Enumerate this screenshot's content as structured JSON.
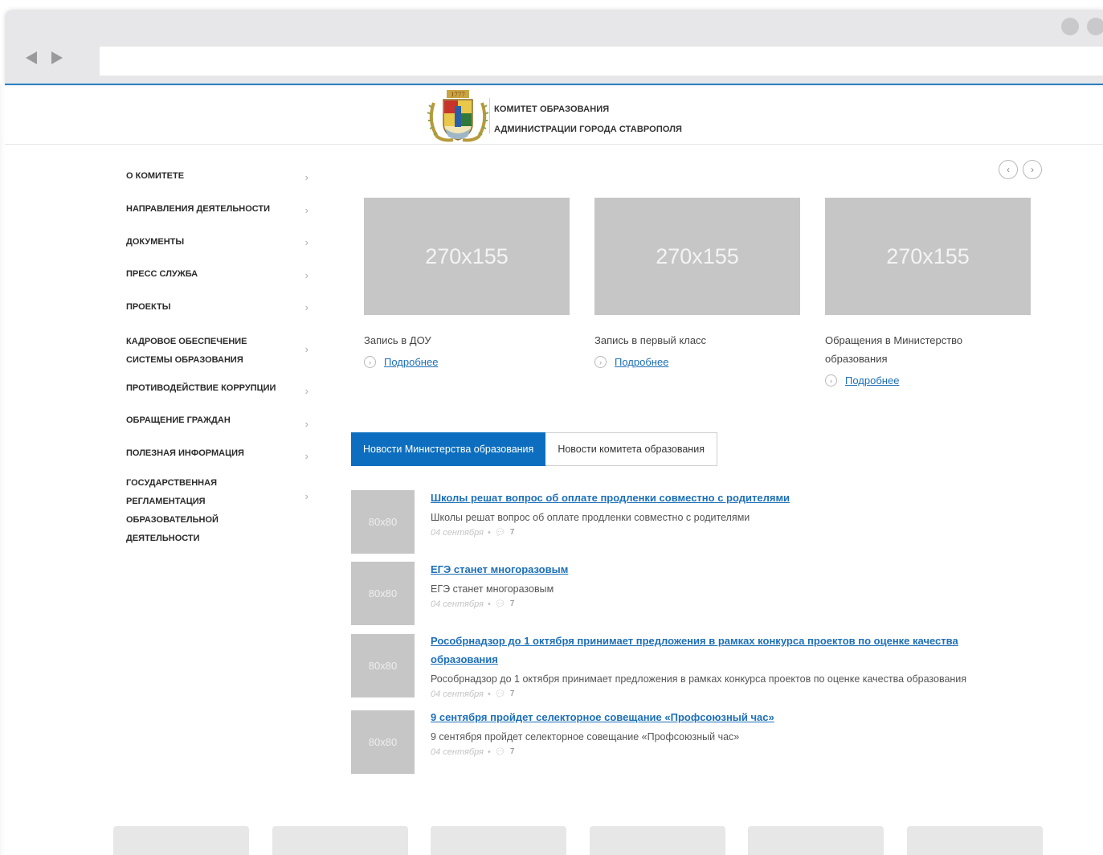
{
  "header": {
    "title_line1": "КОМИТЕТ ОБРАЗОВАНИЯ",
    "title_line2": "АДМИНИСТРАЦИИ ГОРОДА СТАВРОПОЛЯ",
    "emblem_year": "1777",
    "emblem_icon": "coat-of-arms"
  },
  "sidebar": {
    "chevron": "›",
    "items": [
      {
        "label": "О КОМИТЕТЕ"
      },
      {
        "label": "НАПРАВЛЕНИЯ ДЕЯТЕЛЬНОСТИ"
      },
      {
        "label": "ДОКУМЕНТЫ"
      },
      {
        "label": "ПРЕСС СЛУЖБА"
      },
      {
        "label": "ПРОЕКТЫ"
      },
      {
        "label": "КАДРОВОЕ ОБЕСПЕЧЕНИЕ СИСТЕМЫ ОБРАЗОВАНИЯ"
      },
      {
        "label": "ПРОТИВОДЕЙСТВИЕ КОРРУПЦИИ"
      },
      {
        "label": "ОБРАЩЕНИЕ ГРАЖДАН"
      },
      {
        "label": "ПОЛЕЗНАЯ ИНФОРМАЦИЯ"
      },
      {
        "label": "ГОСУДАРСТВЕННАЯ РЕГЛАМЕНТАЦИЯ ОБРАЗОВАТЕЛЬНОЙ ДЕЯТЕЛЬНОСТИ"
      }
    ]
  },
  "carousel": {
    "prev_icon": "‹",
    "next_icon": "›",
    "cards": [
      {
        "image_label": "270x155",
        "title": "Запись в ДОУ",
        "more": "Подробнее"
      },
      {
        "image_label": "270x155",
        "title": "Запись в первый класс",
        "more": "Подробнее"
      },
      {
        "image_label": "270x155",
        "title": "Обращения в Министерство образования",
        "more": "Подробнее"
      }
    ]
  },
  "tabs": [
    {
      "label": "Новости Министерства образования",
      "active": true
    },
    {
      "label": "Новости комитета образования",
      "active": false
    }
  ],
  "news": [
    {
      "thumb": "80x80",
      "title": "Школы решат вопрос об оплате продленки совместно с родителями",
      "desc": "Школы решат вопрос об оплате продленки совместно с родителями",
      "date": "04 сентября",
      "comments": "7"
    },
    {
      "thumb": "80x80",
      "title": "ЕГЭ станет многоразовым",
      "desc": "ЕГЭ станет многоразовым",
      "date": "04 сентября",
      "comments": "7"
    },
    {
      "thumb": "80x80",
      "title": "Рособрнадзор до 1 октября принимает предложения в рамках конкурса проектов по оценке качества образования",
      "desc": "Рособрнадзор до 1 октября принимает предложения в рамках конкурса проектов по оценке качества образования",
      "date": "04 сентября",
      "comments": "7"
    },
    {
      "thumb": "80x80",
      "title": "9 сентября пройдет селекторное совещание «Профсоюзный час»",
      "desc": "9 сентября пройдет селекторное совещание «Профсоюзный час»",
      "date": "04 сентября",
      "comments": "7"
    }
  ],
  "colors": {
    "accent": "#0d6ebf",
    "link": "#1c6fb8",
    "placeholder": "#c6c6c6"
  }
}
